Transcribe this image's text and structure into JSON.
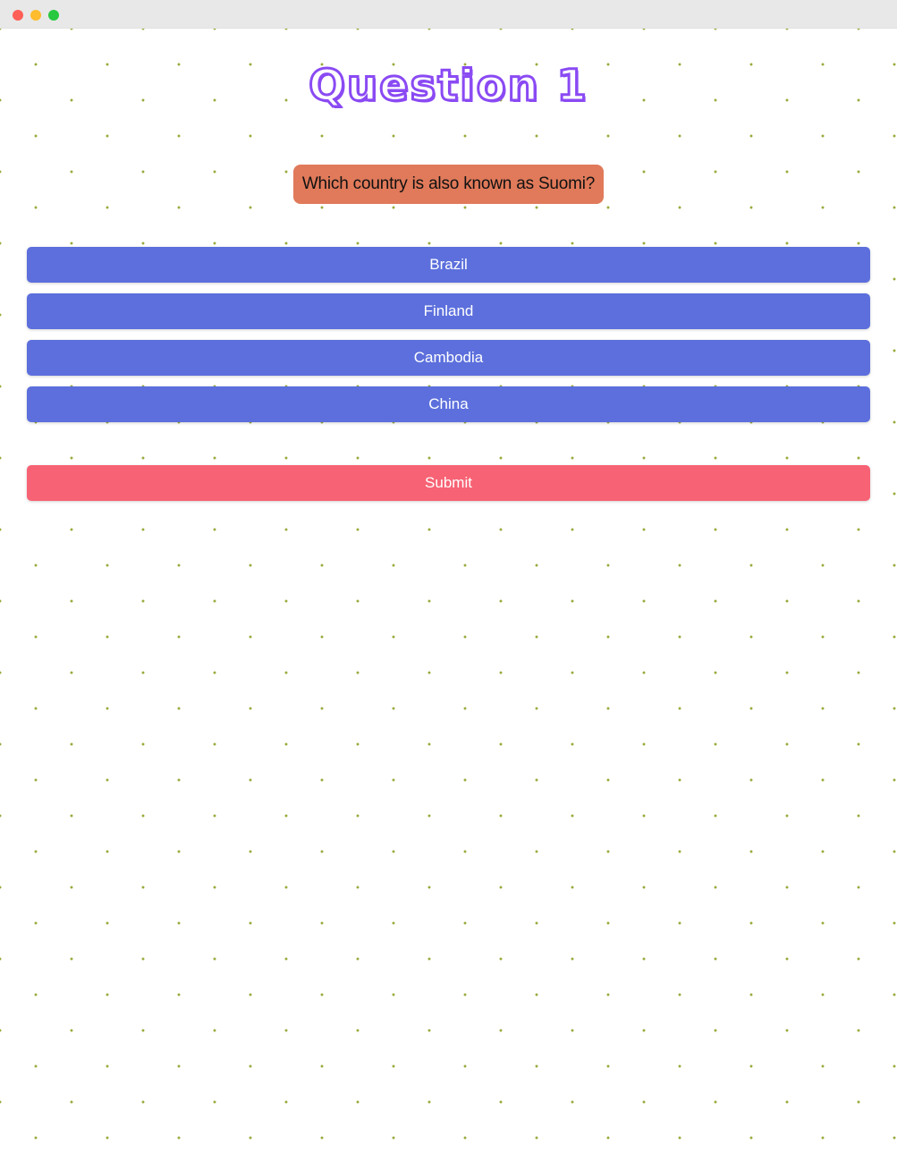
{
  "window": {
    "controls": {
      "close_color": "#ff5f57",
      "minimize_color": "#febc2e",
      "maximize_color": "#28c840"
    }
  },
  "quiz": {
    "title": "Question 1",
    "question": "Which country is also known as Suomi?",
    "options": [
      {
        "label": "Brazil"
      },
      {
        "label": "Finland"
      },
      {
        "label": "Cambodia"
      },
      {
        "label": "China"
      }
    ],
    "submit_label": "Submit"
  },
  "colors": {
    "title_outline": "#8a4af3",
    "question_bg": "#e07a5a",
    "option_bg": "#5c6fdc",
    "submit_bg": "#f76274",
    "background_dots": "#9aaa3c"
  }
}
